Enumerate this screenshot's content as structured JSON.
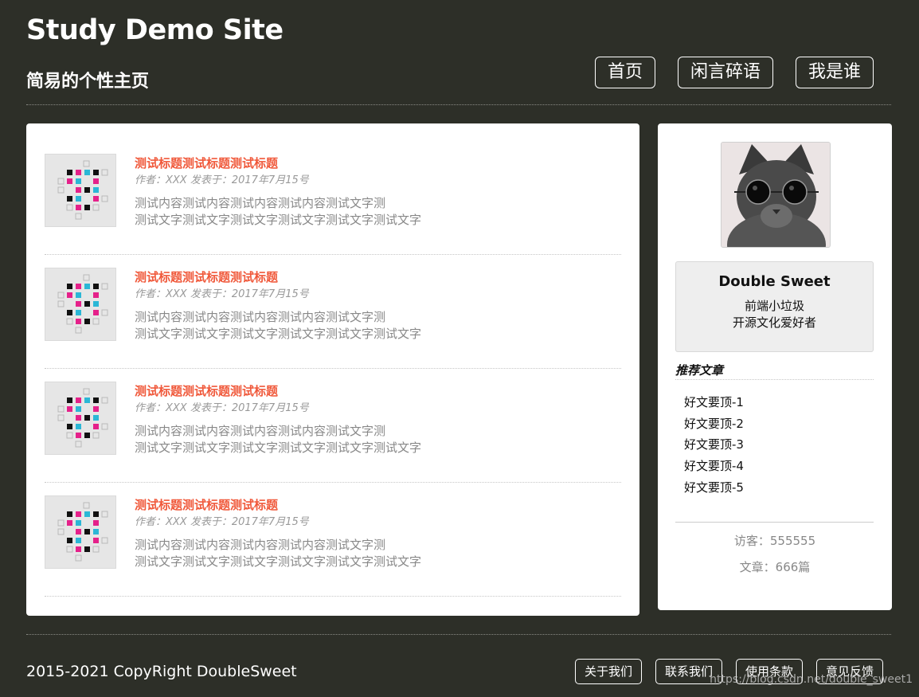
{
  "header": {
    "site_title": "Study Demo Site",
    "subtitle": "简易的个性主页",
    "nav": [
      "首页",
      "闲言碎语",
      "我是谁"
    ]
  },
  "posts": [
    {
      "title": "测试标题测试标题测试标题",
      "meta": "作者：XXX 发表于：2017年7月15号",
      "body1": "测试内容测试内容测试内容测试内容测试文字测",
      "body2": "测试文字测试文字测试文字测试文字测试文字测试文字"
    },
    {
      "title": "测试标题测试标题测试标题",
      "meta": "作者：XXX 发表于：2017年7月15号",
      "body1": "测试内容测试内容测试内容测试内容测试文字测",
      "body2": "测试文字测试文字测试文字测试文字测试文字测试文字"
    },
    {
      "title": "测试标题测试标题测试标题",
      "meta": "作者：XXX 发表于：2017年7月15号",
      "body1": "测试内容测试内容测试内容测试内容测试文字测",
      "body2": "测试文字测试文字测试文字测试文字测试文字测试文字"
    },
    {
      "title": "测试标题测试标题测试标题",
      "meta": "作者：XXX 发表于：2017年7月15号",
      "body1": "测试内容测试内容测试内容测试内容测试文字测",
      "body2": "测试文字测试文字测试文字测试文字测试文字测试文字"
    }
  ],
  "sidebar": {
    "profile_name": "Double Sweet",
    "profile_desc1": "前端小垃圾",
    "profile_desc2": "开源文化爱好者",
    "recommend_title": "推荐文章",
    "recommend": [
      "好文要顶-1",
      "好文要顶-2",
      "好文要顶-3",
      "好文要顶-4",
      "好文要顶-5"
    ],
    "visitors": "访客：555555",
    "articles": "文章：666篇"
  },
  "footer": {
    "copyright": "2015-2021 CopyRight DoubleSweet",
    "links": [
      "关于我们",
      "联系我们",
      "使用条款",
      "意见反馈"
    ],
    "watermark": "https://blog.csdn.net/double_sweet1"
  },
  "colors": {
    "background": "#2d2f28",
    "title_accent": "#f0593b"
  }
}
